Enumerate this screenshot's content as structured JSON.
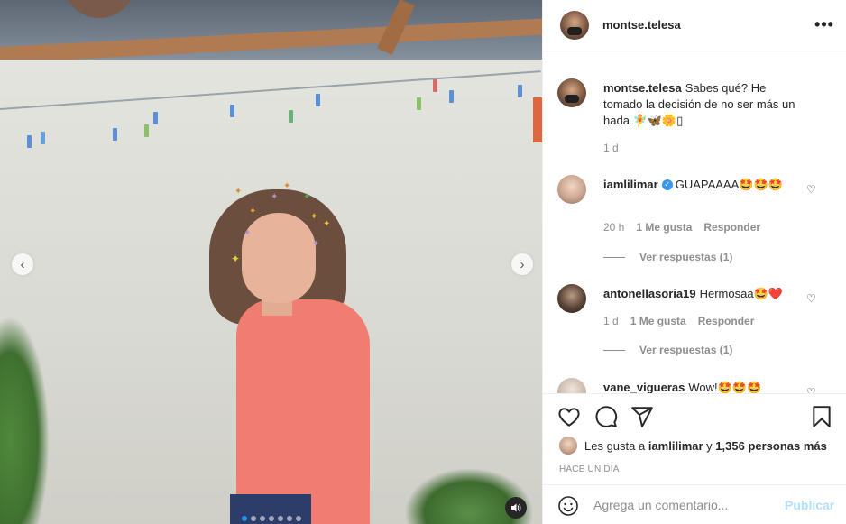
{
  "post": {
    "username": "montse.telesa",
    "caption_user": "montse.telesa",
    "caption_text": "Sabes qué? He tomado la decisión de no ser más un hada 🧚🦋🌼▯",
    "caption_time": "1 d"
  },
  "comments": [
    {
      "username": "iamlilimar",
      "verified": true,
      "text": "GUAPAAAA🤩🤩🤩",
      "time": "20 h",
      "likes": "1 Me gusta",
      "reply": "Responder",
      "view_replies": "Ver respuestas (1)"
    },
    {
      "username": "antonellasoria19",
      "text": "Hermosaa🤩❤️",
      "time": "1 d",
      "likes": "1 Me gusta",
      "reply": "Responder",
      "view_replies": "Ver respuestas (1)"
    },
    {
      "username": "vane_vigueras",
      "text": "Wow!🤩🤩🤩"
    }
  ],
  "likes_line": {
    "prefix": "Les gusta a",
    "user": "iamlilimar",
    "mid": "y",
    "others": "1,356 personas más"
  },
  "posted_ago": "HACE UN DÍA",
  "composer": {
    "placeholder": "Agrega un comentario...",
    "publish_label": "Publicar"
  },
  "carousel": {
    "prev_glyph": "‹",
    "next_glyph": "›",
    "slide_count": 7,
    "active_slide": 0
  },
  "icons": [
    "more-icon",
    "heart-icon",
    "comment-icon",
    "share-icon",
    "bookmark-icon",
    "emoji-icon",
    "audio-icon",
    "verified-icon"
  ],
  "colors": {
    "verified": "#3897f0",
    "active_dot": "#1a95f5",
    "publish_disabled": "#b2dffc",
    "heart_emoji": "#ed4956"
  }
}
